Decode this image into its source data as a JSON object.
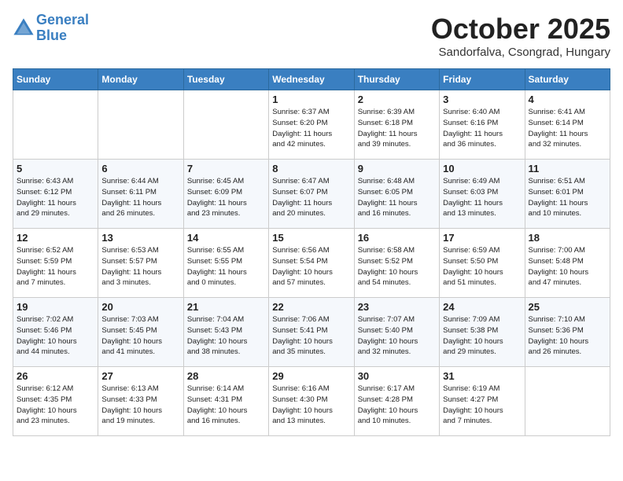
{
  "header": {
    "logo_line1": "General",
    "logo_line2": "Blue",
    "month": "October 2025",
    "location": "Sandorfalva, Csongrad, Hungary"
  },
  "days_of_week": [
    "Sunday",
    "Monday",
    "Tuesday",
    "Wednesday",
    "Thursday",
    "Friday",
    "Saturday"
  ],
  "weeks": [
    [
      {
        "day": "",
        "info": ""
      },
      {
        "day": "",
        "info": ""
      },
      {
        "day": "",
        "info": ""
      },
      {
        "day": "1",
        "info": "Sunrise: 6:37 AM\nSunset: 6:20 PM\nDaylight: 11 hours\nand 42 minutes."
      },
      {
        "day": "2",
        "info": "Sunrise: 6:39 AM\nSunset: 6:18 PM\nDaylight: 11 hours\nand 39 minutes."
      },
      {
        "day": "3",
        "info": "Sunrise: 6:40 AM\nSunset: 6:16 PM\nDaylight: 11 hours\nand 36 minutes."
      },
      {
        "day": "4",
        "info": "Sunrise: 6:41 AM\nSunset: 6:14 PM\nDaylight: 11 hours\nand 32 minutes."
      }
    ],
    [
      {
        "day": "5",
        "info": "Sunrise: 6:43 AM\nSunset: 6:12 PM\nDaylight: 11 hours\nand 29 minutes."
      },
      {
        "day": "6",
        "info": "Sunrise: 6:44 AM\nSunset: 6:11 PM\nDaylight: 11 hours\nand 26 minutes."
      },
      {
        "day": "7",
        "info": "Sunrise: 6:45 AM\nSunset: 6:09 PM\nDaylight: 11 hours\nand 23 minutes."
      },
      {
        "day": "8",
        "info": "Sunrise: 6:47 AM\nSunset: 6:07 PM\nDaylight: 11 hours\nand 20 minutes."
      },
      {
        "day": "9",
        "info": "Sunrise: 6:48 AM\nSunset: 6:05 PM\nDaylight: 11 hours\nand 16 minutes."
      },
      {
        "day": "10",
        "info": "Sunrise: 6:49 AM\nSunset: 6:03 PM\nDaylight: 11 hours\nand 13 minutes."
      },
      {
        "day": "11",
        "info": "Sunrise: 6:51 AM\nSunset: 6:01 PM\nDaylight: 11 hours\nand 10 minutes."
      }
    ],
    [
      {
        "day": "12",
        "info": "Sunrise: 6:52 AM\nSunset: 5:59 PM\nDaylight: 11 hours\nand 7 minutes."
      },
      {
        "day": "13",
        "info": "Sunrise: 6:53 AM\nSunset: 5:57 PM\nDaylight: 11 hours\nand 3 minutes."
      },
      {
        "day": "14",
        "info": "Sunrise: 6:55 AM\nSunset: 5:55 PM\nDaylight: 11 hours\nand 0 minutes."
      },
      {
        "day": "15",
        "info": "Sunrise: 6:56 AM\nSunset: 5:54 PM\nDaylight: 10 hours\nand 57 minutes."
      },
      {
        "day": "16",
        "info": "Sunrise: 6:58 AM\nSunset: 5:52 PM\nDaylight: 10 hours\nand 54 minutes."
      },
      {
        "day": "17",
        "info": "Sunrise: 6:59 AM\nSunset: 5:50 PM\nDaylight: 10 hours\nand 51 minutes."
      },
      {
        "day": "18",
        "info": "Sunrise: 7:00 AM\nSunset: 5:48 PM\nDaylight: 10 hours\nand 47 minutes."
      }
    ],
    [
      {
        "day": "19",
        "info": "Sunrise: 7:02 AM\nSunset: 5:46 PM\nDaylight: 10 hours\nand 44 minutes."
      },
      {
        "day": "20",
        "info": "Sunrise: 7:03 AM\nSunset: 5:45 PM\nDaylight: 10 hours\nand 41 minutes."
      },
      {
        "day": "21",
        "info": "Sunrise: 7:04 AM\nSunset: 5:43 PM\nDaylight: 10 hours\nand 38 minutes."
      },
      {
        "day": "22",
        "info": "Sunrise: 7:06 AM\nSunset: 5:41 PM\nDaylight: 10 hours\nand 35 minutes."
      },
      {
        "day": "23",
        "info": "Sunrise: 7:07 AM\nSunset: 5:40 PM\nDaylight: 10 hours\nand 32 minutes."
      },
      {
        "day": "24",
        "info": "Sunrise: 7:09 AM\nSunset: 5:38 PM\nDaylight: 10 hours\nand 29 minutes."
      },
      {
        "day": "25",
        "info": "Sunrise: 7:10 AM\nSunset: 5:36 PM\nDaylight: 10 hours\nand 26 minutes."
      }
    ],
    [
      {
        "day": "26",
        "info": "Sunrise: 6:12 AM\nSunset: 4:35 PM\nDaylight: 10 hours\nand 23 minutes."
      },
      {
        "day": "27",
        "info": "Sunrise: 6:13 AM\nSunset: 4:33 PM\nDaylight: 10 hours\nand 19 minutes."
      },
      {
        "day": "28",
        "info": "Sunrise: 6:14 AM\nSunset: 4:31 PM\nDaylight: 10 hours\nand 16 minutes."
      },
      {
        "day": "29",
        "info": "Sunrise: 6:16 AM\nSunset: 4:30 PM\nDaylight: 10 hours\nand 13 minutes."
      },
      {
        "day": "30",
        "info": "Sunrise: 6:17 AM\nSunset: 4:28 PM\nDaylight: 10 hours\nand 10 minutes."
      },
      {
        "day": "31",
        "info": "Sunrise: 6:19 AM\nSunset: 4:27 PM\nDaylight: 10 hours\nand 7 minutes."
      },
      {
        "day": "",
        "info": ""
      }
    ]
  ]
}
